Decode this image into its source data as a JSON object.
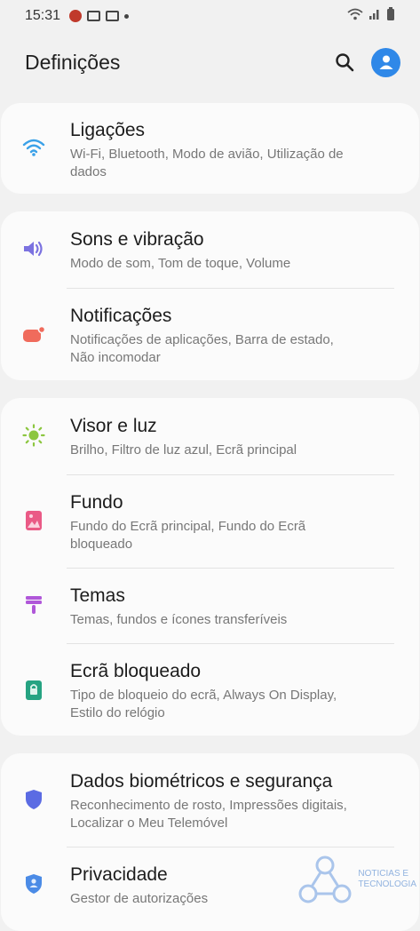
{
  "status_bar": {
    "time": "15:31"
  },
  "header": {
    "title": "Definições"
  },
  "settings": [
    {
      "title": "Ligações",
      "subtitle_lines": [
        "Wi-Fi, Bluetooth, Modo de avião, Utilização de",
        "dados"
      ],
      "icon": "wifi-icon",
      "icon_color": "#3aa1e8"
    },
    {
      "title": "Sons e vibração",
      "subtitle_lines": [
        "Modo de som, Tom de toque, Volume"
      ],
      "icon": "speaker-icon",
      "icon_color": "#7b72e0"
    },
    {
      "title": "Notificações",
      "subtitle_lines": [
        "Notificações de aplicações, Barra de estado,",
        "Não incomodar"
      ],
      "icon": "notification-icon",
      "icon_color": "#f06b5c"
    },
    {
      "title": "Visor e luz",
      "subtitle_lines": [
        "Brilho, Filtro de luz azul, Ecrã principal"
      ],
      "icon": "sun-icon",
      "icon_color": "#8cc63f"
    },
    {
      "title": "Fundo",
      "subtitle_lines": [
        "Fundo do Ecrã principal, Fundo do Ecrã",
        "bloqueado"
      ],
      "icon": "wallpaper-icon",
      "icon_color": "#ea5a86"
    },
    {
      "title": "Temas",
      "subtitle_lines": [
        "Temas, fundos e ícones transferíveis"
      ],
      "icon": "brush-icon",
      "icon_color": "#b057d9"
    },
    {
      "title": "Ecrã bloqueado",
      "subtitle_lines": [
        "Tipo de bloqueio do ecrã, Always On Display,",
        "Estilo do relógio"
      ],
      "icon": "lock-icon",
      "icon_color": "#26a382"
    },
    {
      "title": "Dados biométricos e segurança",
      "subtitle_lines": [
        "Reconhecimento de rosto, Impressões digitais,",
        "Localizar o Meu Telemóvel"
      ],
      "icon": "shield-icon",
      "icon_color": "#5b6be3"
    },
    {
      "title": "Privacidade",
      "subtitle_lines": [
        "Gestor de autorizações"
      ],
      "icon": "privacy-shield-icon",
      "icon_color": "#4b8be6"
    }
  ],
  "watermark": {
    "line1": "NOTICIAS E",
    "line2": "TECNOLOGIA"
  }
}
